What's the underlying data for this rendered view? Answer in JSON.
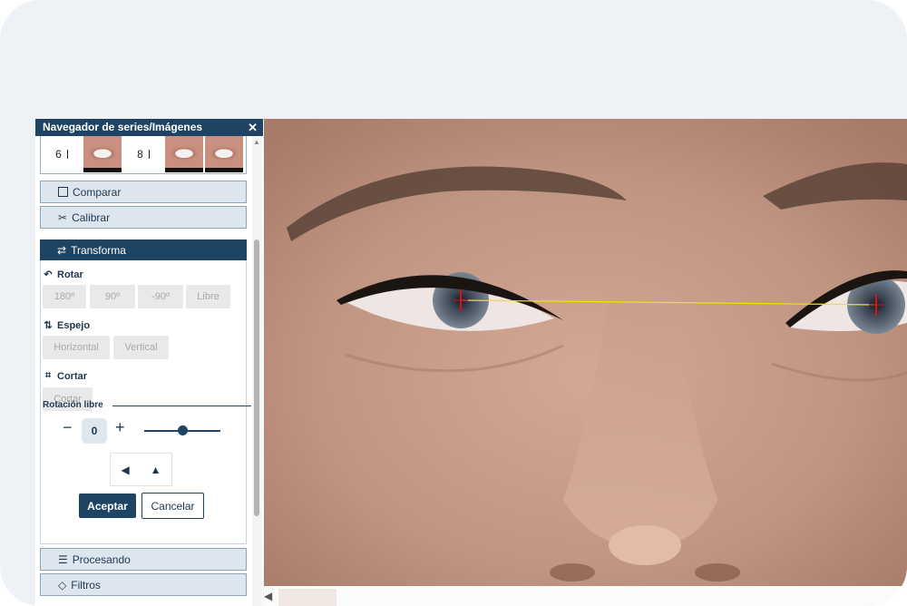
{
  "panel": {
    "title": "Navegador de series/Imágenes",
    "close": "✕",
    "thumbs": [
      "6",
      "8"
    ]
  },
  "sections": {
    "compare": "Comparar",
    "calibrate": "Calibrar",
    "transform": "Transforma",
    "processing": "Procesando",
    "filters": "Filtros"
  },
  "transform": {
    "rotate_label": "Rotar",
    "rotate_options": [
      "180º",
      "90º",
      "-90º",
      "Libre"
    ],
    "mirror_label": "Espejo",
    "mirror_options": [
      "Horizontal",
      "Vertical"
    ],
    "crop_label": "Cortar",
    "crop_option": "Cortar",
    "free_rotation_label": "Rotación libre",
    "free_rotation_value": "0",
    "slider_fraction": 0.5,
    "accept": "Aceptar",
    "cancel": "Cancelar"
  },
  "icons": {
    "close": "close-icon",
    "checkbox": "checkbox-icon",
    "calibrate": "ruler-cross-icon",
    "transform": "swap-icon",
    "rotate": "rotate-icon",
    "mirror": "mirror-icon",
    "crop": "crop-icon",
    "processing": "sliders-icon",
    "filters": "drop-icon"
  },
  "colors": {
    "primary": "#1f4463",
    "section_bg": "#dde6ee",
    "guide_line": "#f2e600",
    "pupil_mark": "#d4141b"
  }
}
